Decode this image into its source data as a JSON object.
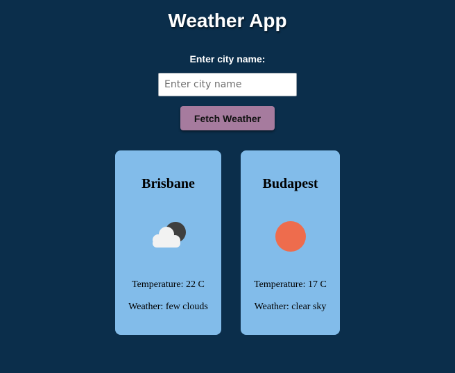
{
  "app": {
    "title": "Weather App"
  },
  "search": {
    "label": "Enter city name:",
    "placeholder": "Enter city name",
    "value": ""
  },
  "fetch_button": {
    "label": "Fetch Weather"
  },
  "cards": [
    {
      "city": "Brisbane",
      "icon": "few-clouds-night-icon",
      "temperature": "Temperature: 22 C",
      "weather": "Weather: few clouds"
    },
    {
      "city": "Budapest",
      "icon": "clear-sky-sun-icon",
      "temperature": "Temperature: 17 C",
      "weather": "Weather: clear sky"
    }
  ],
  "colors": {
    "background": "#0b2e4b",
    "card": "#82bcea",
    "button": "#a67b9e",
    "sun": "#ee6c4d",
    "moon": "#3f3f3f",
    "cloud": "#f2f2f2"
  }
}
